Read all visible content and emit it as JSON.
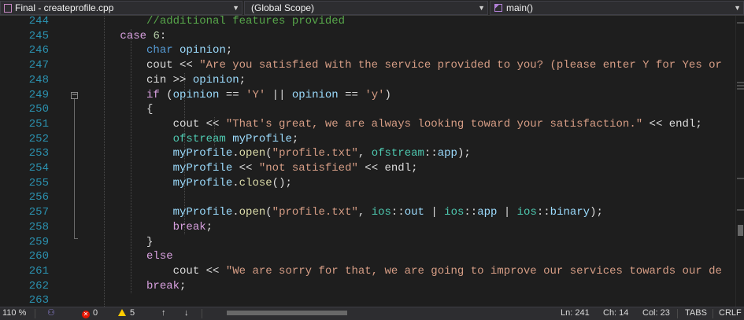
{
  "navbar": {
    "file_label": "Final - createprofile.cpp",
    "scope_label": "(Global Scope)",
    "member_label": "main()",
    "file_icon": "cpp-file-icon",
    "member_icon": "method-cube-icon"
  },
  "gutter": {
    "line_numbers": [
      "244",
      "245",
      "246",
      "247",
      "248",
      "249",
      "250",
      "251",
      "252",
      "253",
      "254",
      "255",
      "256",
      "257",
      "258",
      "259",
      "260",
      "261",
      "262",
      "263"
    ]
  },
  "code_lines": [
    [
      {
        "c": "t-cmt",
        "t": "          //additional features provided"
      }
    ],
    [
      {
        "c": "t-plain",
        "t": "      "
      },
      {
        "c": "t-ctl",
        "t": "case"
      },
      {
        "c": "t-plain",
        "t": " "
      },
      {
        "c": "t-num",
        "t": "6"
      },
      {
        "c": "t-plain",
        "t": ":"
      }
    ],
    [
      {
        "c": "t-plain",
        "t": "          "
      },
      {
        "c": "t-kw",
        "t": "char"
      },
      {
        "c": "t-plain",
        "t": " "
      },
      {
        "c": "t-var",
        "t": "opinion"
      },
      {
        "c": "t-plain",
        "t": ";"
      }
    ],
    [
      {
        "c": "t-plain",
        "t": "          cout << "
      },
      {
        "c": "t-str",
        "t": "\"Are you satisfied with the service provided to you? (please enter Y for Yes or"
      }
    ],
    [
      {
        "c": "t-plain",
        "t": "          cin >> "
      },
      {
        "c": "t-var",
        "t": "opinion"
      },
      {
        "c": "t-plain",
        "t": ";"
      }
    ],
    [
      {
        "c": "t-plain",
        "t": "          "
      },
      {
        "c": "t-ctl",
        "t": "if"
      },
      {
        "c": "t-plain",
        "t": " ("
      },
      {
        "c": "t-var",
        "t": "opinion"
      },
      {
        "c": "t-plain",
        "t": " == "
      },
      {
        "c": "t-str",
        "t": "'Y'"
      },
      {
        "c": "t-plain",
        "t": " || "
      },
      {
        "c": "t-var",
        "t": "opinion"
      },
      {
        "c": "t-plain",
        "t": " == "
      },
      {
        "c": "t-str",
        "t": "'y'"
      },
      {
        "c": "t-plain",
        "t": ")"
      }
    ],
    [
      {
        "c": "t-plain",
        "t": "          {"
      }
    ],
    [
      {
        "c": "t-plain",
        "t": "              cout << "
      },
      {
        "c": "t-str",
        "t": "\"That's great, we are always looking toward your satisfaction.\""
      },
      {
        "c": "t-plain",
        "t": " << endl;"
      }
    ],
    [
      {
        "c": "t-plain",
        "t": "              "
      },
      {
        "c": "t-type",
        "t": "ofstream"
      },
      {
        "c": "t-plain",
        "t": " "
      },
      {
        "c": "t-var",
        "t": "myProfile"
      },
      {
        "c": "t-plain",
        "t": ";"
      }
    ],
    [
      {
        "c": "t-plain",
        "t": "              "
      },
      {
        "c": "t-var",
        "t": "myProfile"
      },
      {
        "c": "t-plain",
        "t": "."
      },
      {
        "c": "t-fn",
        "t": "open"
      },
      {
        "c": "t-plain",
        "t": "("
      },
      {
        "c": "t-str",
        "t": "\"profile.txt\""
      },
      {
        "c": "t-plain",
        "t": ", "
      },
      {
        "c": "t-type",
        "t": "ofstream"
      },
      {
        "c": "t-plain",
        "t": "::"
      },
      {
        "c": "t-var",
        "t": "app"
      },
      {
        "c": "t-plain",
        "t": ");"
      }
    ],
    [
      {
        "c": "t-plain",
        "t": "              "
      },
      {
        "c": "t-var",
        "t": "myProfile"
      },
      {
        "c": "t-plain",
        "t": " << "
      },
      {
        "c": "t-str",
        "t": "\"not satisfied\""
      },
      {
        "c": "t-plain",
        "t": " << endl;"
      }
    ],
    [
      {
        "c": "t-plain",
        "t": "              "
      },
      {
        "c": "t-var",
        "t": "myProfile"
      },
      {
        "c": "t-plain",
        "t": "."
      },
      {
        "c": "t-fn",
        "t": "close"
      },
      {
        "c": "t-plain",
        "t": "();"
      }
    ],
    [
      {
        "c": "t-plain",
        "t": ""
      }
    ],
    [
      {
        "c": "t-plain",
        "t": "              "
      },
      {
        "c": "t-var",
        "t": "myProfile"
      },
      {
        "c": "t-plain",
        "t": "."
      },
      {
        "c": "t-fn",
        "t": "open"
      },
      {
        "c": "t-plain",
        "t": "("
      },
      {
        "c": "t-str",
        "t": "\"profile.txt\""
      },
      {
        "c": "t-plain",
        "t": ", "
      },
      {
        "c": "t-type",
        "t": "ios"
      },
      {
        "c": "t-plain",
        "t": "::"
      },
      {
        "c": "t-var",
        "t": "out"
      },
      {
        "c": "t-plain",
        "t": " | "
      },
      {
        "c": "t-type",
        "t": "ios"
      },
      {
        "c": "t-plain",
        "t": "::"
      },
      {
        "c": "t-var",
        "t": "app"
      },
      {
        "c": "t-plain",
        "t": " | "
      },
      {
        "c": "t-type",
        "t": "ios"
      },
      {
        "c": "t-plain",
        "t": "::"
      },
      {
        "c": "t-var",
        "t": "binary"
      },
      {
        "c": "t-plain",
        "t": ");"
      }
    ],
    [
      {
        "c": "t-plain",
        "t": "              "
      },
      {
        "c": "t-ctl",
        "t": "break"
      },
      {
        "c": "t-plain",
        "t": ";"
      }
    ],
    [
      {
        "c": "t-plain",
        "t": "          }"
      }
    ],
    [
      {
        "c": "t-plain",
        "t": "          "
      },
      {
        "c": "t-ctl",
        "t": "else"
      }
    ],
    [
      {
        "c": "t-plain",
        "t": "              cout << "
      },
      {
        "c": "t-str",
        "t": "\"We are sorry for that, we are going to improve our services towards our de"
      }
    ],
    [
      {
        "c": "t-plain",
        "t": "          "
      },
      {
        "c": "t-ctl",
        "t": "break"
      },
      {
        "c": "t-plain",
        "t": ";"
      }
    ],
    [
      {
        "c": "t-plain",
        "t": ""
      }
    ]
  ],
  "editor": {
    "fold_toggle_line": "249",
    "fold_toggle_glyph": "−"
  },
  "status": {
    "zoom": "110 %",
    "errors": "0",
    "warnings": "5",
    "error_icon": "error-circle-icon",
    "warning_icon": "warning-triangle-icon",
    "nav_up": "↑",
    "nav_down": "↓",
    "ln": "Ln: 241",
    "ch": "Ch: 14",
    "col": "Col: 23",
    "tabs": "TABS",
    "eol": "CRLF"
  }
}
